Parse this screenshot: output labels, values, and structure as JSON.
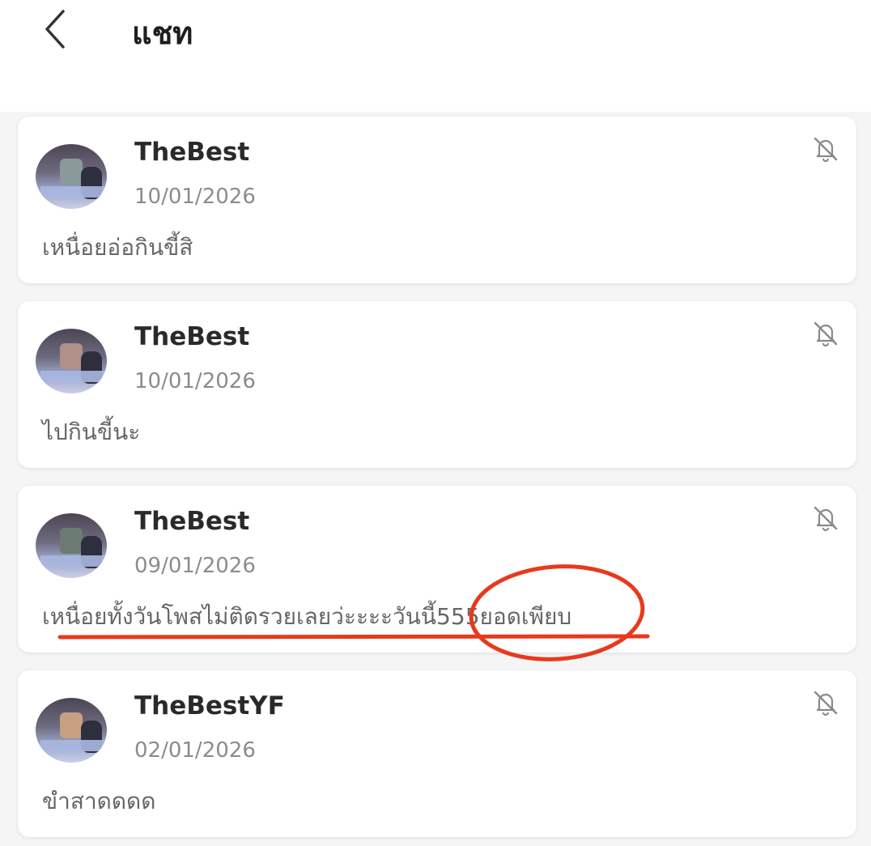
{
  "header": {
    "title": "แชท",
    "back_icon": "chevron-left-icon"
  },
  "chats": [
    {
      "name": "TheBest",
      "date": "10/01/2026",
      "message": "เหนื่อยอ่อกินขี้สิ",
      "icon": "bell-off-icon"
    },
    {
      "name": "TheBest",
      "date": "10/01/2026",
      "message": "ไปกินขี้นะ",
      "icon": "bell-off-icon"
    },
    {
      "name": "TheBest",
      "date": "09/01/2026",
      "message": "เหนื่อยทั้งวันโพสไม่ติดรวยเลยว่ะะะะวันนี้555ยอดเพียบ",
      "icon": "bell-off-icon"
    },
    {
      "name": "TheBestYF",
      "date": "02/01/2026",
      "message": "ขำสาดดดด",
      "icon": "bell-off-icon"
    }
  ],
  "colors": {
    "annotation": "#e8391c",
    "background": "#f5f5f5"
  }
}
